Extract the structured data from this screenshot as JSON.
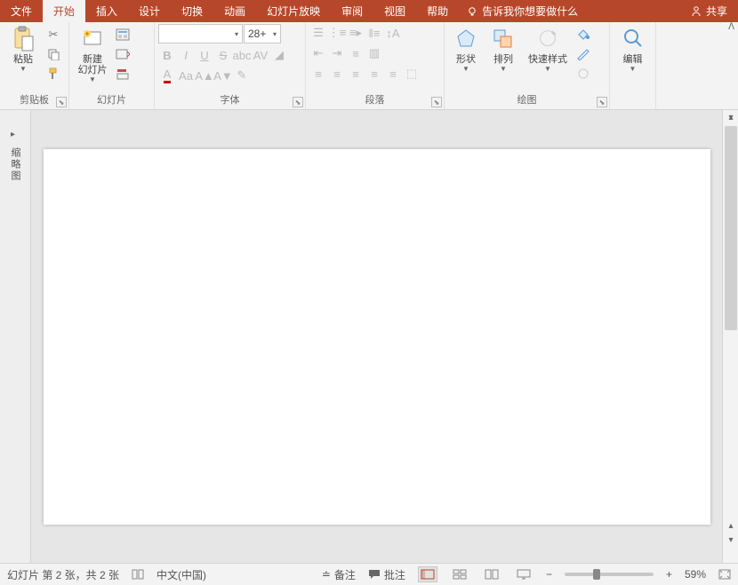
{
  "tabs": {
    "file": "文件",
    "home": "开始",
    "insert": "插入",
    "design": "设计",
    "transitions": "切换",
    "animations": "动画",
    "slideshow": "幻灯片放映",
    "review": "审阅",
    "view": "视图",
    "help": "帮助"
  },
  "tell_me": "告诉我你想要做什么",
  "share": "共享",
  "ribbon": {
    "clipboard": {
      "label": "剪贴板",
      "paste": "粘贴"
    },
    "slides": {
      "label": "幻灯片",
      "new_slide": "新建\n幻灯片"
    },
    "font": {
      "label": "字体",
      "size": "28+"
    },
    "paragraph": {
      "label": "段落"
    },
    "drawing": {
      "label": "绘图",
      "shapes": "形状",
      "arrange": "排列",
      "quick_styles": "快速样式"
    },
    "editing": {
      "label": "编辑"
    }
  },
  "thumb_pane": {
    "title": "缩略图"
  },
  "status": {
    "slide_info": "幻灯片 第 2 张，共 2 张",
    "language": "中文(中国)",
    "notes": "备注",
    "comments": "批注",
    "zoom": "59%"
  }
}
